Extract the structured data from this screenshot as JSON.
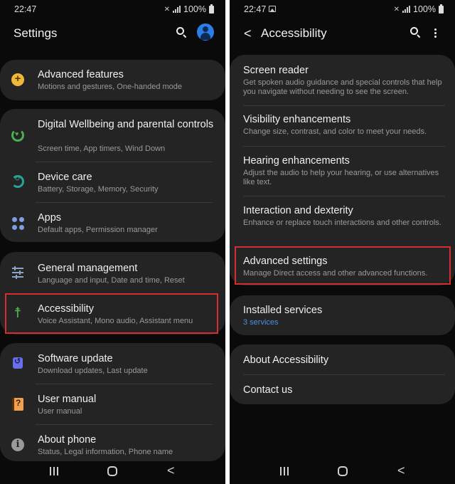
{
  "left_screen": {
    "status": {
      "time": "22:47",
      "battery": "100%"
    },
    "appbar": {
      "title": "Settings",
      "search_icon": "search-icon",
      "profile_icon": "profile-icon"
    },
    "items": [
      {
        "label": "Advanced features",
        "sub": "Motions and gestures, One-handed mode",
        "icon": "gear-plus-icon",
        "icon_color": "#f0b83a"
      },
      {
        "label": "Digital Wellbeing and parental controls",
        "sub": "Screen time, App timers, Wind Down",
        "icon": "wellbeing-icon",
        "icon_color": "#4caf50"
      },
      {
        "label": "Device care",
        "sub": "Battery, Storage, Memory, Security",
        "icon": "device-care-icon",
        "icon_color": "#26a69a"
      },
      {
        "label": "Apps",
        "sub": "Default apps, Permission manager",
        "icon": "apps-icon",
        "icon_color": "#7b9fe0"
      },
      {
        "label": "General management",
        "sub": "Language and input, Date and time, Reset",
        "icon": "sliders-icon",
        "icon_color": "#8aa6c4"
      },
      {
        "label": "Accessibility",
        "sub": "Voice Assistant, Mono audio, Assistant menu",
        "icon": "accessibility-icon",
        "icon_color": "#4caf50",
        "highlighted": true
      },
      {
        "label": "Software update",
        "sub": "Download updates, Last update",
        "icon": "software-update-icon",
        "icon_color": "#6a6ee8"
      },
      {
        "label": "User manual",
        "sub": "User manual",
        "icon": "user-manual-icon",
        "icon_color": "#f0a050"
      },
      {
        "label": "About phone",
        "sub": "Status, Legal information, Phone name",
        "icon": "info-icon",
        "icon_color": "#9a9a9a"
      }
    ]
  },
  "right_screen": {
    "status": {
      "time": "22:47",
      "battery": "100%"
    },
    "appbar": {
      "title": "Accessibility",
      "back_icon": "back-icon",
      "search_icon": "search-icon",
      "more_icon": "more-options-icon"
    },
    "items": [
      {
        "label": "Screen reader",
        "sub": "Get spoken audio guidance and special controls that help you navigate without needing to see the screen."
      },
      {
        "label": "Visibility enhancements",
        "sub": "Change size, contrast, and color to meet your needs."
      },
      {
        "label": "Hearing enhancements",
        "sub": "Adjust the audio to help your hearing, or use alternatives like text."
      },
      {
        "label": "Interaction and dexterity",
        "sub": "Enhance or replace touch interactions and other controls."
      },
      {
        "label": "Advanced settings",
        "sub": "Manage Direct access and other advanced functions.",
        "highlighted": true
      },
      {
        "label": "Installed services",
        "sub": "3 services",
        "sub_color": "#4d8fe0"
      },
      {
        "label": "About Accessibility"
      },
      {
        "label": "Contact us"
      }
    ]
  },
  "colors": {
    "highlight": "#d32f2f",
    "background": "#0a0a0a",
    "card": "#242424",
    "link": "#4d8fe0"
  }
}
